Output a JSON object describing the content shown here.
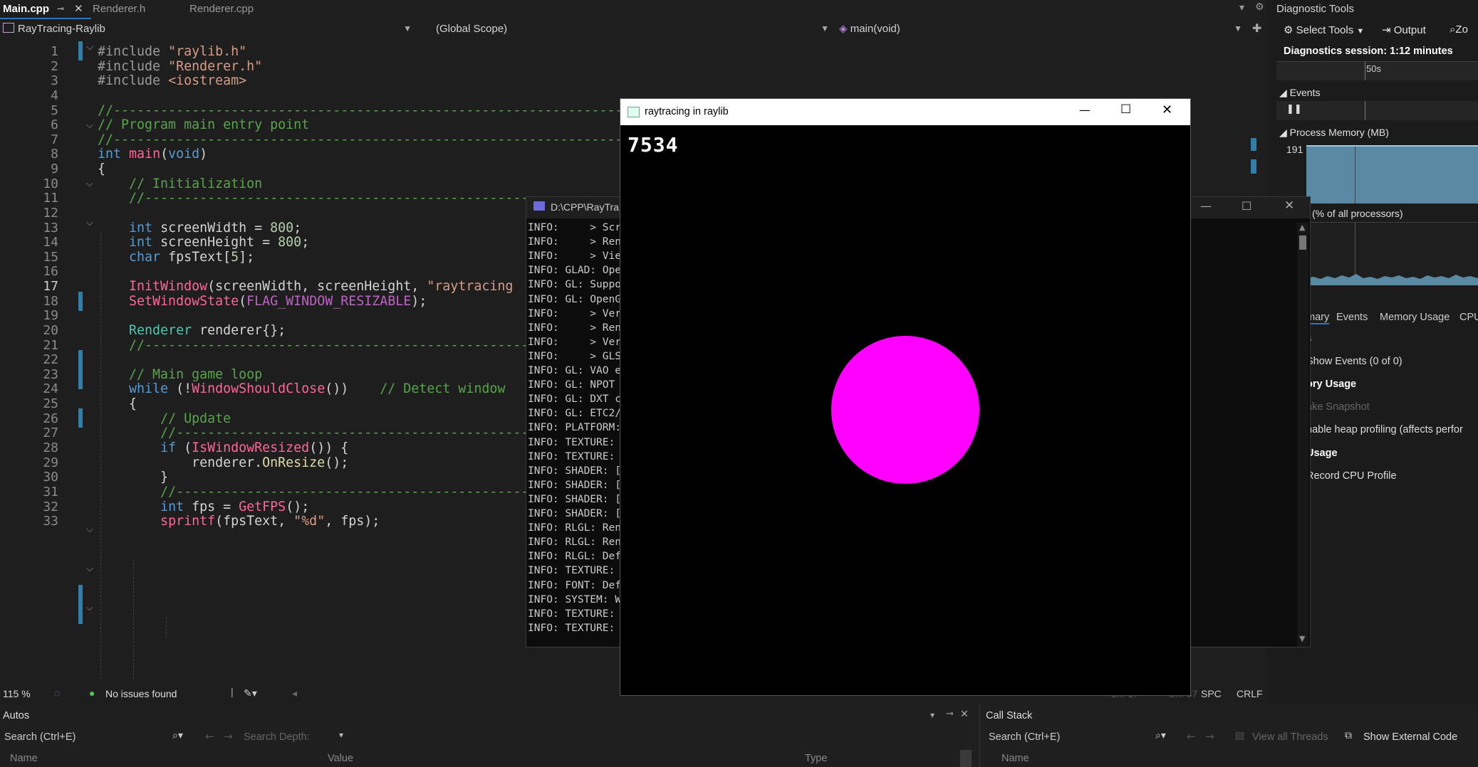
{
  "tabs": [
    {
      "label": "Main.cpp",
      "active": true
    },
    {
      "label": "Renderer.h"
    },
    {
      "label": "Renderer.cpp"
    }
  ],
  "nav": {
    "project": "RayTracing-Raylib",
    "scope": "(Global Scope)",
    "member": "main(void)"
  },
  "code": [
    {
      "n": "1",
      "t": "#include \"raylib.h\""
    },
    {
      "n": "2",
      "t": "#include \"Renderer.h\""
    },
    {
      "n": "3",
      "t": "#include <iostream>"
    },
    {
      "n": "4",
      "t": ""
    },
    {
      "n": "5",
      "t": "//-------------------------------------------------------------------------"
    },
    {
      "n": "6",
      "t": "// Program main entry point"
    },
    {
      "n": "7",
      "t": "//-------------------------------------------------------------------------"
    },
    {
      "n": "8",
      "t": "int main(void)"
    },
    {
      "n": "9",
      "t": "{"
    },
    {
      "n": "10",
      "t": "    // Initialization"
    },
    {
      "n": "11",
      "t": "    //-----------------------------------------------------------"
    },
    {
      "n": "12",
      "t": ""
    },
    {
      "n": "13",
      "t": "    int screenWidth = 800;"
    },
    {
      "n": "14",
      "t": "    int screenHeight = 800;"
    },
    {
      "n": "15",
      "t": "    char fpsText[5];"
    },
    {
      "n": "16",
      "t": ""
    },
    {
      "n": "17",
      "t": "    InitWindow(screenWidth, screenHeight, \"raytracing"
    },
    {
      "n": "18",
      "t": "    SetWindowState(FLAG_WINDOW_RESIZABLE);"
    },
    {
      "n": "19",
      "t": ""
    },
    {
      "n": "20",
      "t": "    Renderer renderer{};"
    },
    {
      "n": "21",
      "t": "    //-----------------------------------------------------------"
    },
    {
      "n": "22",
      "t": ""
    },
    {
      "n": "23",
      "t": "    // Main game loop"
    },
    {
      "n": "24",
      "t": "    while (!WindowShouldClose())    // Detect window"
    },
    {
      "n": "25",
      "t": "    {"
    },
    {
      "n": "26",
      "t": "        // Update"
    },
    {
      "n": "27",
      "t": "        //-------------------------------------------------------"
    },
    {
      "n": "28",
      "t": "        if (IsWindowResized()) {"
    },
    {
      "n": "29",
      "t": "            renderer.OnResize();"
    },
    {
      "n": "30",
      "t": "        }"
    },
    {
      "n": "31",
      "t": "        //-------------------------------------------------------"
    },
    {
      "n": "32",
      "t": "        int fps = GetFPS();"
    },
    {
      "n": "33",
      "t": "        sprintf(fpsText, \"%d\", fps);"
    }
  ],
  "status": {
    "zoom": "115 %",
    "issues": "No issues found",
    "ln": "Ln: 17",
    "ch": "Ch: 37",
    "spc": "SPC",
    "crlf": "CRLF"
  },
  "raylib": {
    "title": "raytracing in raylib",
    "fps": "7534",
    "circle_color": "#ff00ff"
  },
  "console": {
    "title": "D:\\CPP\\RayTra",
    "lines": [
      "INFO:     > Scr",
      "INFO:     > Ren",
      "INFO:     > Vie",
      "INFO: GLAD: Ope",
      "INFO: GL: Suppo",
      "INFO: GL: OpenG",
      "INFO:     > Ver",
      "INFO:     > Ren",
      "INFO:     > Ver",
      "INFO:     > GLS",
      "INFO: GL: VAO e",
      "INFO: GL: NPOT ",
      "INFO: GL: DXT c",
      "INFO: GL: ETC2/",
      "INFO: PLATFORM:",
      "INFO: TEXTURE: ",
      "INFO: TEXTURE: ",
      "INFO: SHADER: [",
      "INFO: SHADER: [",
      "INFO: SHADER: [",
      "INFO: SHADER: [",
      "INFO: RLGL: Ren",
      "INFO: RLGL: Ren",
      "INFO: RLGL: Def",
      "INFO: TEXTURE: ",
      "INFO: FONT: Def",
      "INFO: SYSTEM: W",
      "INFO: TEXTURE: ",
      "INFO: TEXTURE: "
    ]
  },
  "diag": {
    "title": "Diagnostic Tools",
    "select_tools": "Select Tools",
    "output": "Output",
    "zoom": "Zo",
    "session": "Diagnostics session: 1:12 minutes",
    "tick": "50s",
    "events": "Events",
    "process_memory": "Process Memory (MB)",
    "mem_value": "191",
    "cpu": "(% of all processors)",
    "tabs": [
      "mary",
      "Events",
      "Memory Usage",
      "CPU"
    ],
    "items": [
      {
        "t": "s",
        "bold": false
      },
      {
        "t": "Show Events (0 of 0)",
        "bold": false
      },
      {
        "t": "ory Usage",
        "bold": true
      },
      {
        "t": "ake Snapshot",
        "bold": false,
        "dim": true
      },
      {
        "t": "nable heap profiling (affects perfor",
        "bold": false
      },
      {
        "t": "Usage",
        "bold": true
      },
      {
        "t": "Record CPU Profile",
        "bold": false
      }
    ]
  },
  "autos": {
    "title": "Autos",
    "search": "Search (Ctrl+E)",
    "depth": "Search Depth:",
    "cols": [
      "Name",
      "Value",
      "Type"
    ]
  },
  "callstack": {
    "title": "Call Stack",
    "search": "Search (Ctrl+E)",
    "view_all": "View all Threads",
    "show_external": "Show External Code",
    "cols": [
      "Name"
    ]
  }
}
